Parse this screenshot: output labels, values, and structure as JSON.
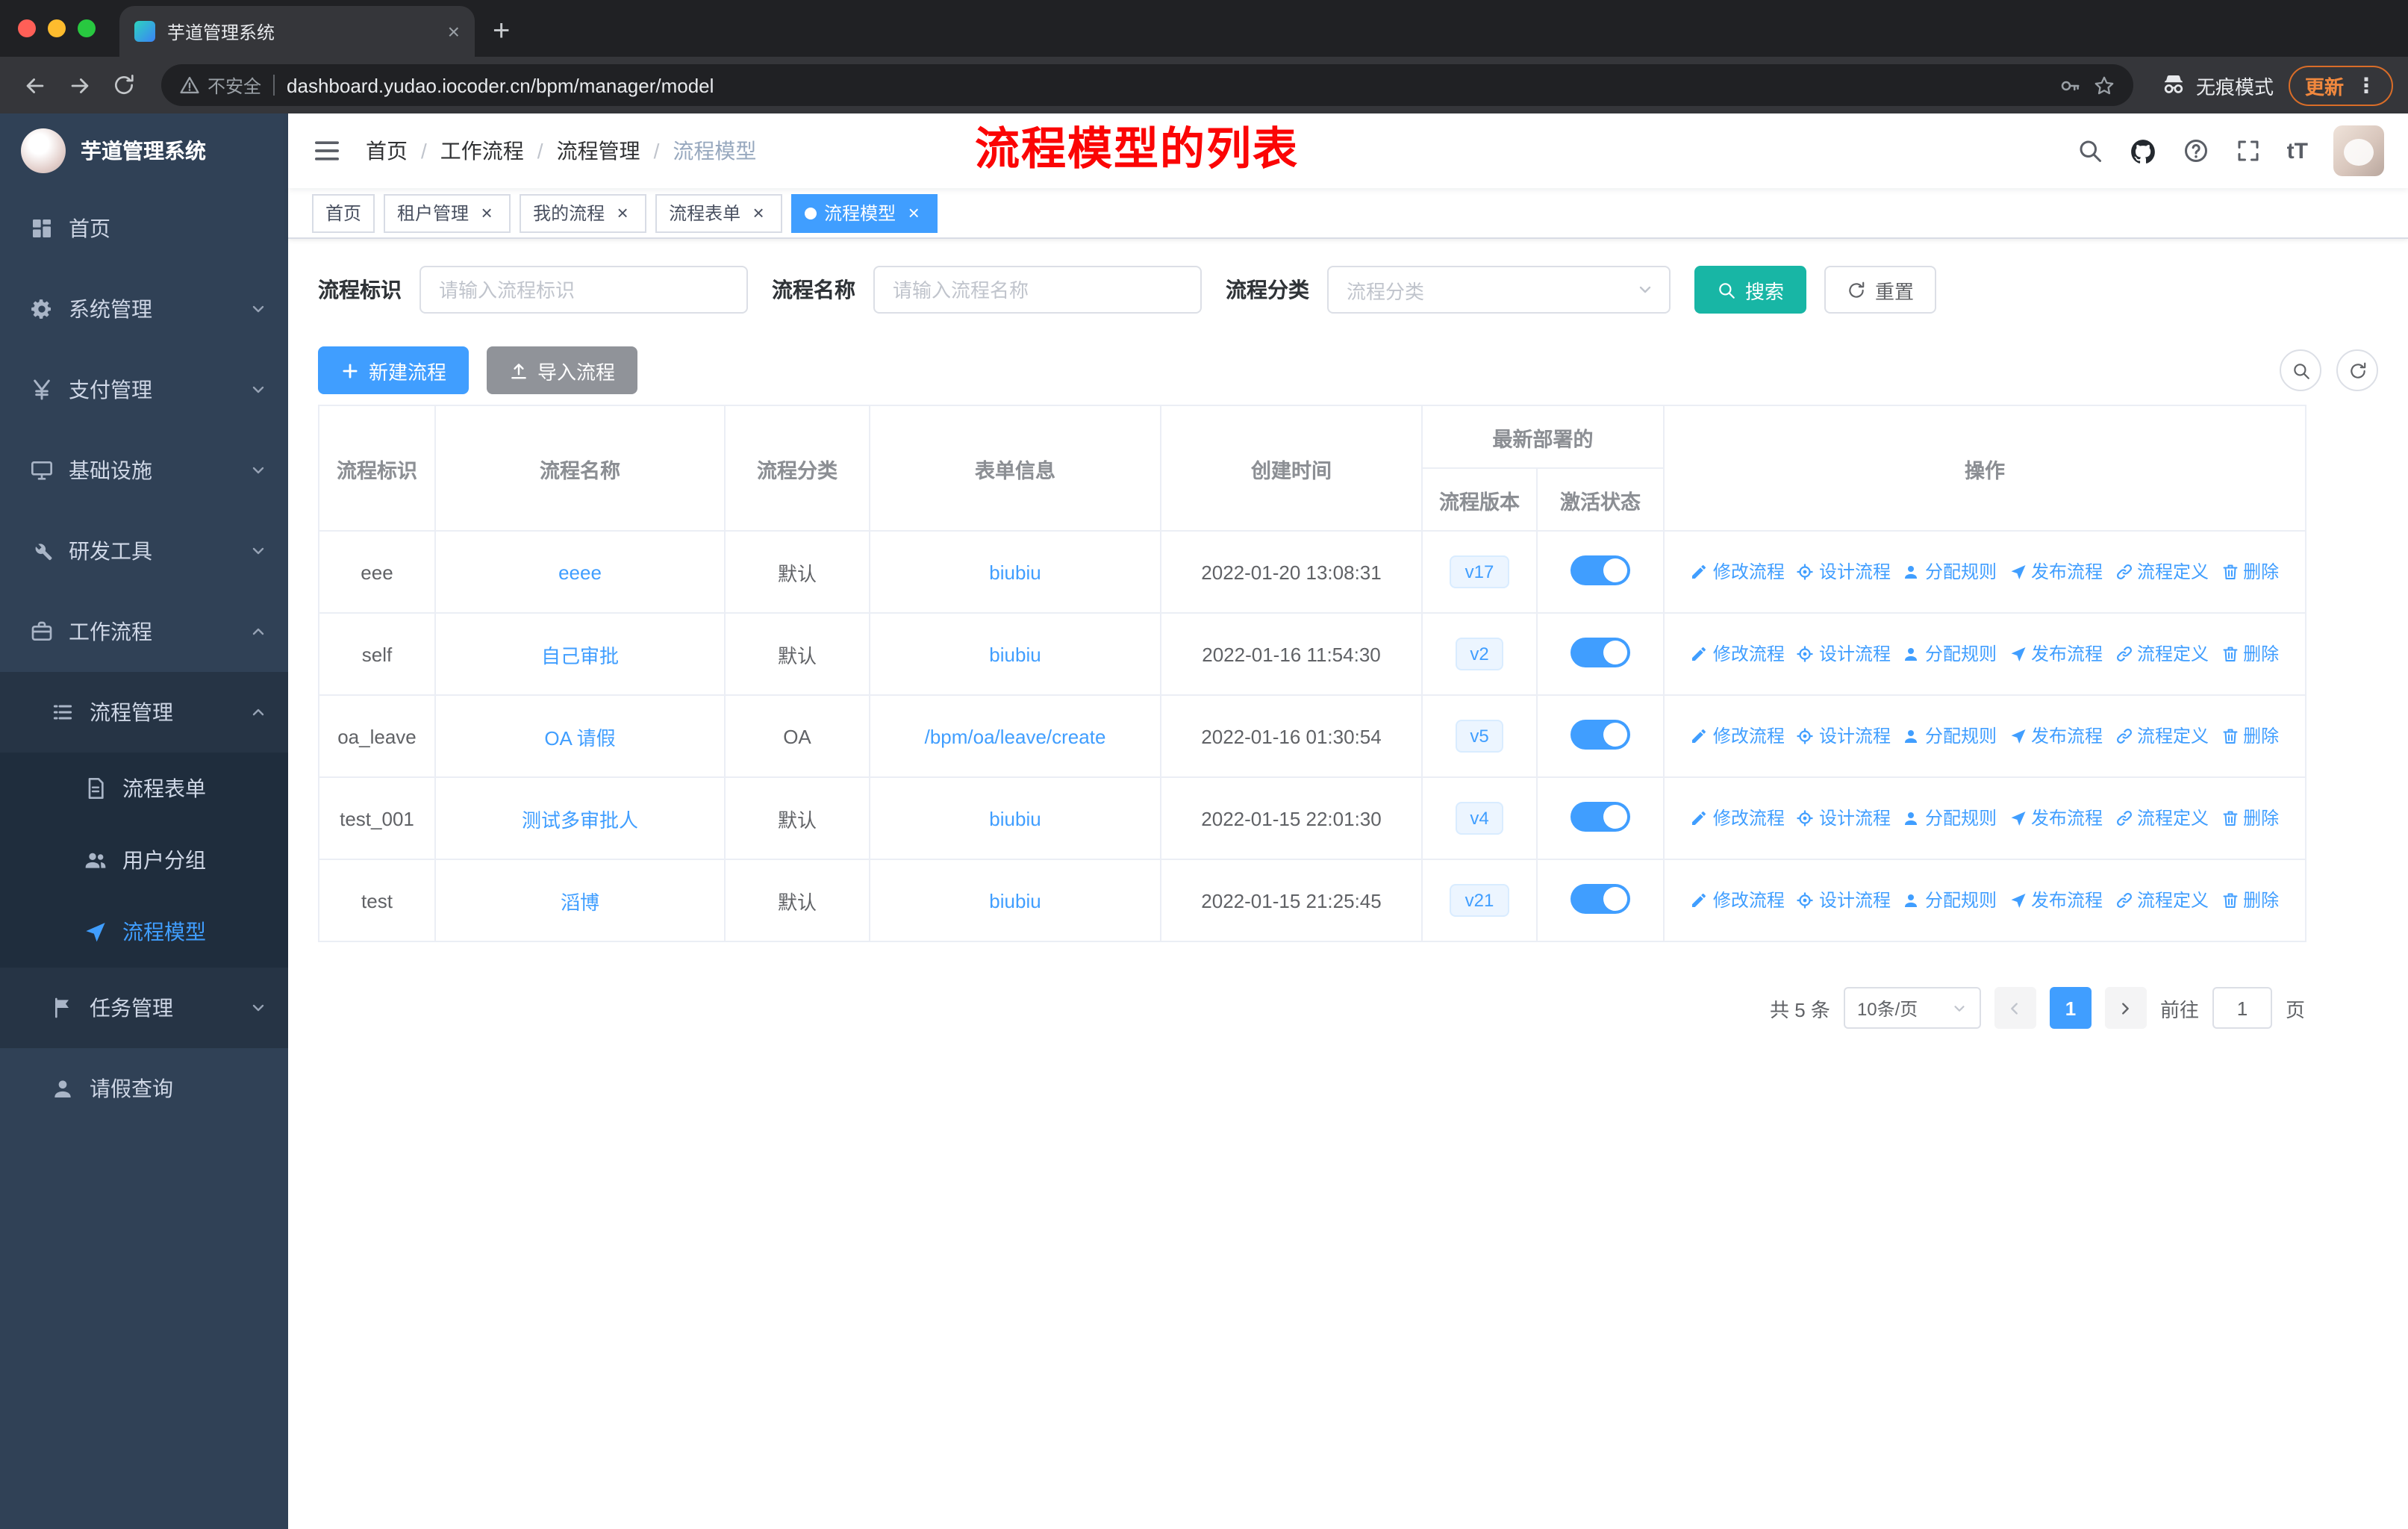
{
  "colors": {
    "primary": "#409eff",
    "search_button_teal": "#18b6a5",
    "annotation_red": "#fb0505",
    "sidebar_bg": "#304156",
    "sidebar_submenu_bg": "#263445",
    "sidebar_submenu2_bg": "#1f2d3d",
    "tag_active_bg": "#409eff",
    "toggle_on": "#409eff",
    "version_badge_bg": "#ecf5ff"
  },
  "browser": {
    "tab_title": "芋道管理系统",
    "security_label": "不安全",
    "url": "dashboard.yudao.iocoder.cn/bpm/manager/model",
    "incognito_label": "无痕模式",
    "update_label": "更新"
  },
  "sidebar": {
    "logo_text": "芋道管理系统",
    "menu": [
      {
        "label": "首页",
        "icon": "dashboard-icon"
      },
      {
        "label": "系统管理",
        "icon": "gear-icon"
      },
      {
        "label": "支付管理",
        "icon": "payment-icon"
      },
      {
        "label": "基础设施",
        "icon": "infrastructure-icon"
      },
      {
        "label": "研发工具",
        "icon": "dev-tools-icon"
      },
      {
        "label": "工作流程",
        "icon": "workflow-icon"
      }
    ],
    "process_group_label": "流程管理",
    "process_children": [
      {
        "label": "流程表单",
        "icon": "form-icon"
      },
      {
        "label": "用户分组",
        "icon": "user-group-icon"
      },
      {
        "label": "流程模型",
        "icon": "paper-plane-icon",
        "active": true
      }
    ],
    "task_group_label": "任务管理",
    "leave_label": "请假查询"
  },
  "header": {
    "breadcrumb": [
      "首页",
      "工作流程",
      "流程管理",
      "流程模型"
    ],
    "annotation": "流程模型的列表"
  },
  "tags": {
    "items": [
      "首页",
      "租户管理",
      "我的流程",
      "流程表单",
      "流程模型"
    ]
  },
  "filters": {
    "key_label": "流程标识",
    "key_placeholder": "请输入流程标识",
    "name_label": "流程名称",
    "name_placeholder": "请输入流程名称",
    "category_label": "流程分类",
    "category_placeholder": "流程分类",
    "search_label": "搜索",
    "reset_label": "重置"
  },
  "toolbar": {
    "create_label": "新建流程",
    "import_label": "导入流程"
  },
  "table": {
    "columns": [
      "流程标识",
      "流程名称",
      "流程分类",
      "表单信息",
      "创建时间",
      "流程版本",
      "激活状态",
      "操作"
    ],
    "group_header": "最新部署的",
    "rows": [
      {
        "key": "eee",
        "name": "eeee",
        "category": "默认",
        "form": "biubiu",
        "created": "2022-01-20 13:08:31",
        "version": "v17",
        "active": true
      },
      {
        "key": "self",
        "name": "自己审批",
        "category": "默认",
        "form": "biubiu",
        "created": "2022-01-16 11:54:30",
        "version": "v2",
        "active": true
      },
      {
        "key": "oa_leave",
        "name": "OA 请假",
        "category": "OA",
        "form": "/bpm/oa/leave/create",
        "created": "2022-01-16 01:30:54",
        "version": "v5",
        "active": true
      },
      {
        "key": "test_001",
        "name": "测试多审批人",
        "category": "默认",
        "form": "biubiu",
        "created": "2022-01-15 22:01:30",
        "version": "v4",
        "active": true
      },
      {
        "key": "test",
        "name": "滔博",
        "category": "默认",
        "form": "biubiu",
        "created": "2022-01-15 21:25:45",
        "version": "v21",
        "active": true
      }
    ],
    "row_actions": [
      {
        "label": "修改流程",
        "icon": "edit-icon"
      },
      {
        "label": "设计流程",
        "icon": "design-icon"
      },
      {
        "label": "分配规则",
        "icon": "assign-user-icon"
      },
      {
        "label": "发布流程",
        "icon": "publish-icon"
      },
      {
        "label": "流程定义",
        "icon": "definition-link-icon"
      },
      {
        "label": "删除",
        "icon": "delete-icon"
      }
    ]
  },
  "pagination": {
    "total": "共 5 条",
    "page_size": "10条/页",
    "current_page": "1",
    "goto_label": "前往",
    "goto_value": "1",
    "unit_label": "页"
  }
}
